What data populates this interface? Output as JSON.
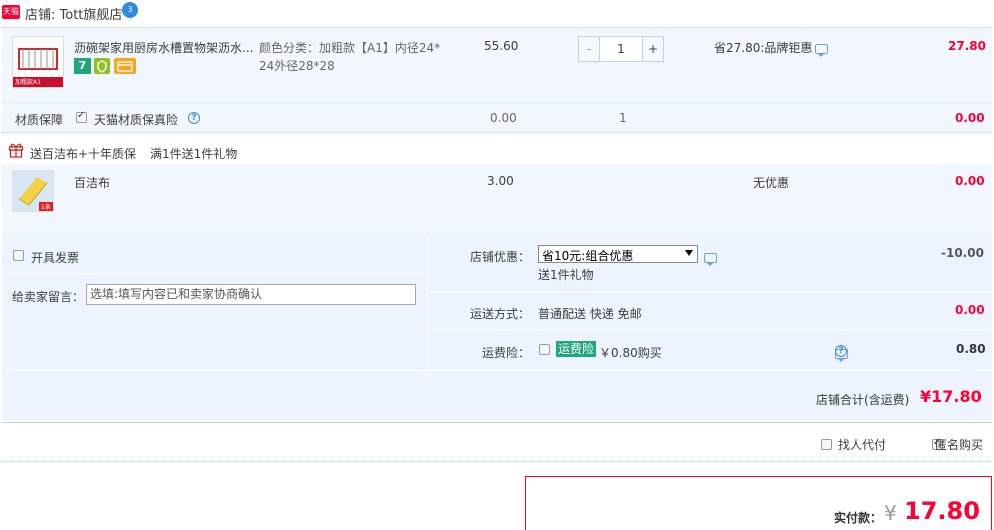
{
  "shop": {
    "badge": "天猫",
    "name": "店铺: Tott旗舰店",
    "ww_badge": "3"
  },
  "item": {
    "title": "沥碗架家用厨房水槽置物架沥水...",
    "sku_line1": "颜色分类：加粗款【A1】内径24*",
    "sku_line2": "24外径28*28",
    "price": "55.60",
    "qty": "1",
    "qty_minus": "-",
    "qty_plus": "+",
    "promo": "省27.80:品牌钜惠",
    "total": "27.80",
    "thumb_caption": "加粗款A1",
    "badge_7": "7"
  },
  "insurance": {
    "label": "材质保障",
    "option": "天猫材质保真险",
    "price": "0.00",
    "qty": "1",
    "total": "0.00"
  },
  "gift": {
    "header": "送百洁布+十年质保",
    "rule": "满1件送1件礼物",
    "name": "百洁布",
    "price": "3.00",
    "promo": "无优惠",
    "total": "0.00",
    "thumb_caption": "1条"
  },
  "order": {
    "invoice_label": "开具发票",
    "message_label": "给卖家留言：",
    "message_placeholder": "选填:填写内容已和卖家协商确认",
    "shop_discount_label": "店铺优惠：",
    "shop_discount_select": "省10元:组合优惠",
    "shop_discount_sub": "送1件礼物",
    "shop_discount_amount": "-10.00",
    "shipping_label": "运送方式：",
    "shipping_value": "普通配送 快递 免邮",
    "shipping_amount": "0.00",
    "freight_ins_label": "运费险：",
    "freight_ins_tag": "运费险",
    "freight_ins_value": "￥0.80购买",
    "freight_ins_amount": "0.80",
    "subtotal_label": "店铺合计(含运费)",
    "subtotal_amount": "¥17.80"
  },
  "footer": {
    "proxy_pay": "找人代付",
    "anonymous": "匿名购买",
    "pay_label": "实付款：",
    "pay_currency": "¥",
    "pay_amount": "17.80"
  },
  "colors": {
    "accent_red": "#ff0036",
    "row_blue": "#f2f7ff",
    "order_blue": "#eef4ff",
    "link_blue": "#3c8ddc",
    "tag_green": "#21a67a",
    "tag_yellow": "#f5a623"
  }
}
